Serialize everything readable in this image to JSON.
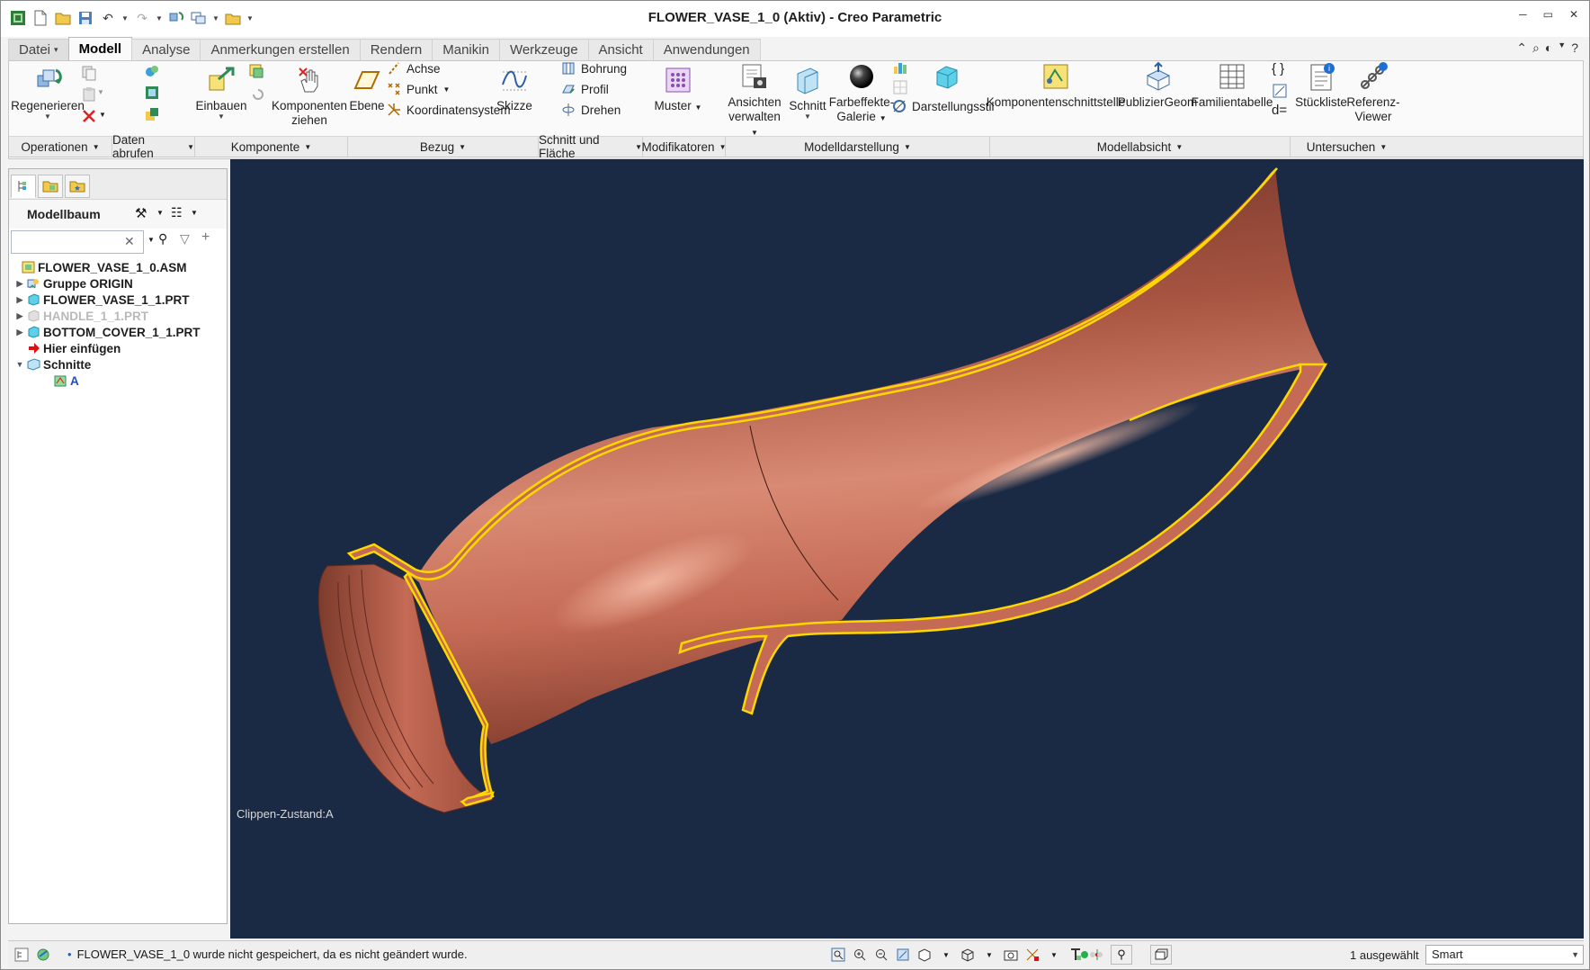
{
  "window": {
    "title": "FLOWER_VASE_1_0 (Aktiv) - Creo Parametric",
    "controls": [
      "─",
      "▭",
      "✕"
    ]
  },
  "tabs": [
    {
      "label": "Datei",
      "caret": "▾"
    },
    {
      "label": "Modell",
      "active": true
    },
    {
      "label": "Analyse"
    },
    {
      "label": "Anmerkungen erstellen"
    },
    {
      "label": "Rendern"
    },
    {
      "label": "Manikin"
    },
    {
      "label": "Werkzeuge"
    },
    {
      "label": "Ansicht"
    },
    {
      "label": "Anwendungen"
    }
  ],
  "ribbon": {
    "regenerieren": "Regenerieren",
    "einbauen": "Einbauen",
    "komponenten_ziehen_1": "Komponenten",
    "komponenten_ziehen_2": "ziehen",
    "ebene": "Ebene",
    "achse": "Achse",
    "punkt": "Punkt",
    "koordinatensystem": "Koordinatensystem",
    "skizze": "Skizze",
    "bohrung": "Bohrung",
    "profil": "Profil",
    "drehen": "Drehen",
    "muster": "Muster",
    "ansichten_1": "Ansichten",
    "ansichten_2": "verwalten",
    "schnitt": "Schnitt",
    "farbeffekte_1": "Farbeffekte-",
    "farbeffekte_2": "Galerie",
    "darstellungsstil": "Darstellungsstil",
    "komponentenschnittstelle": "Komponentenschnittstelle",
    "publiziergeom": "PublizierGeom",
    "familientabelle": "Familientabelle",
    "stueckliste": "Stückliste",
    "referenz_1": "Referenz-",
    "referenz_2": "Viewer",
    "relations_label": "d="
  },
  "groups": [
    {
      "label": "Operationen"
    },
    {
      "label": "Daten abrufen"
    },
    {
      "label": "Komponente"
    },
    {
      "label": "Bezug"
    },
    {
      "label": "Schnitt und Fläche"
    },
    {
      "label": "Modifikatoren"
    },
    {
      "label": "Modelldarstellung"
    },
    {
      "label": "Modellabsicht"
    },
    {
      "label": "Untersuchen"
    }
  ],
  "tree": {
    "title": "Modellbaum",
    "search_value": "",
    "search_clear": "✕",
    "items": [
      {
        "label": "FLOWER_VASE_1_0.ASM",
        "expander": ""
      },
      {
        "label": "Gruppe ORIGIN",
        "expander": "▶"
      },
      {
        "label": "FLOWER_VASE_1_1.PRT",
        "expander": "▶"
      },
      {
        "label": "HANDLE_1_1.PRT",
        "expander": "▶"
      },
      {
        "label": "BOTTOM_COVER_1_1.PRT",
        "expander": "▶"
      },
      {
        "label": "Hier einfügen",
        "expander": ""
      },
      {
        "label": "Schnitte",
        "expander": "▼"
      },
      {
        "label": "A",
        "expander": ""
      }
    ]
  },
  "viewport": {
    "clip_state": "Clippen-Zustand:A"
  },
  "status": {
    "message": "FLOWER_VASE_1_0 wurde nicht gespeichert, da es nicht geändert wurde.",
    "bullet": "•",
    "selection_count": "1 ausgewählt",
    "filter_value": "Smart"
  },
  "colors": {
    "viewport_bg": "#1a2a44",
    "model_copper": "#c46a55",
    "section_edge": "#ffd700"
  }
}
